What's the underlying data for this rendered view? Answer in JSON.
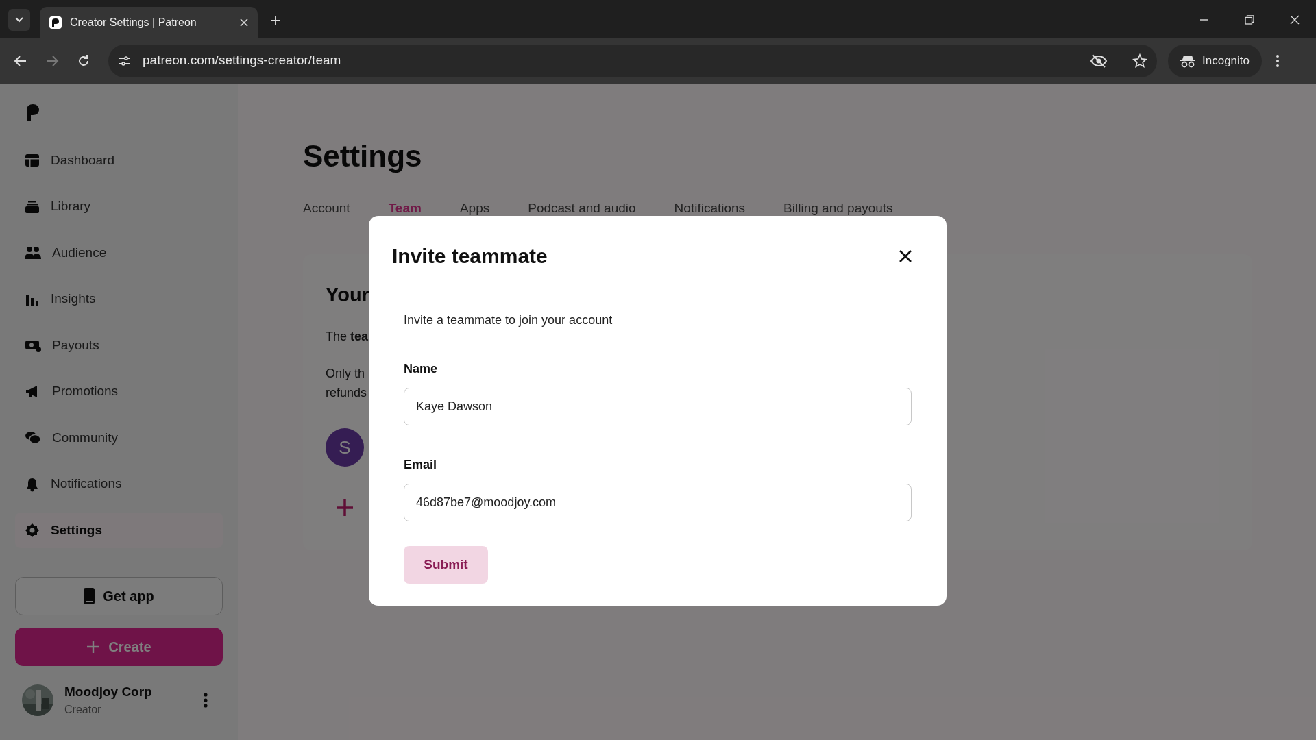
{
  "browser": {
    "tab_title": "Creator Settings | Patreon",
    "url": "patreon.com/settings-creator/team",
    "profile_label": "Incognito"
  },
  "sidebar": {
    "items": [
      {
        "label": "Dashboard",
        "selected": false
      },
      {
        "label": "Library",
        "selected": false
      },
      {
        "label": "Audience",
        "selected": false
      },
      {
        "label": "Insights",
        "selected": false
      },
      {
        "label": "Payouts",
        "selected": false
      },
      {
        "label": "Promotions",
        "selected": false
      },
      {
        "label": "Community",
        "selected": false
      },
      {
        "label": "Notifications",
        "selected": false
      },
      {
        "label": "Settings",
        "selected": true
      }
    ],
    "get_app_button": "Get app",
    "create_button": "Create",
    "user": {
      "name": "Moodjoy Corp",
      "role": "Creator"
    }
  },
  "page": {
    "title": "Settings",
    "tabs": [
      {
        "label": "Account",
        "selected": false
      },
      {
        "label": "Team",
        "selected": true
      },
      {
        "label": "Apps",
        "selected": false
      },
      {
        "label": "Podcast and audio",
        "selected": false
      },
      {
        "label": "Notifications",
        "selected": false
      },
      {
        "label": "Billing and payouts",
        "selected": false
      }
    ],
    "card": {
      "heading": "Your",
      "line_1": "The **tea**",
      "line_2": "Only th",
      "line_3": "refunds",
      "avatar_letter": "S"
    }
  },
  "modal": {
    "title": "Invite teammate",
    "description": "Invite a teammate to join your account",
    "fields": [
      {
        "label": "Name",
        "value": "Kaye Dawson"
      },
      {
        "label": "Email",
        "value": "46d87be7@moodjoy.com"
      }
    ],
    "submit_button": "Submit"
  }
}
